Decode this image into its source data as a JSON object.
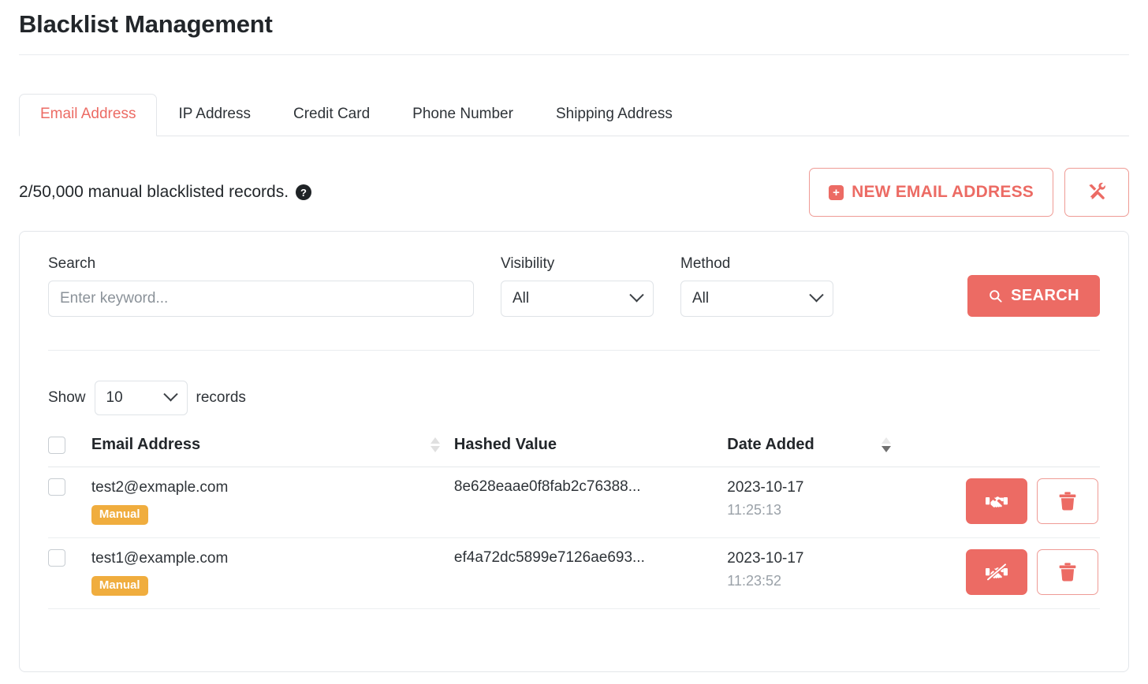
{
  "page": {
    "title": "Blacklist Management"
  },
  "tabs": [
    {
      "label": "Email Address",
      "active": true
    },
    {
      "label": "IP Address",
      "active": false
    },
    {
      "label": "Credit Card",
      "active": false
    },
    {
      "label": "Phone Number",
      "active": false
    },
    {
      "label": "Shipping Address",
      "active": false
    }
  ],
  "counter": {
    "text": "2/50,000 manual blacklisted records.",
    "help_icon": "question-circle-icon",
    "used": 2,
    "limit": "50,000"
  },
  "actions": {
    "new_record_label": "NEW EMAIL ADDRESS",
    "new_record_icon": "plus-square-icon",
    "plus_glyph": "+",
    "tools_icon": "tools-icon"
  },
  "filters": {
    "search": {
      "label": "Search",
      "placeholder": "Enter keyword...",
      "value": ""
    },
    "visibility": {
      "label": "Visibility",
      "value": "All",
      "options": [
        "All"
      ],
      "icon": "chevron-down-icon"
    },
    "method": {
      "label": "Method",
      "value": "All",
      "options": [
        "All"
      ],
      "icon": "chevron-down-icon"
    },
    "search_button": {
      "label": "SEARCH",
      "icon": "search-icon"
    }
  },
  "pagination": {
    "show_label": "Show",
    "page_size": "10",
    "page_size_options": [
      "10"
    ],
    "records_label": "records",
    "icon": "chevron-down-icon"
  },
  "table": {
    "columns": [
      {
        "key": "select",
        "label": "",
        "sortable": false
      },
      {
        "key": "email",
        "label": "Email Address",
        "sortable": true,
        "sort": "none"
      },
      {
        "key": "hash",
        "label": "Hashed Value",
        "sortable": false
      },
      {
        "key": "date",
        "label": "Date Added",
        "sortable": true,
        "sort": "desc"
      },
      {
        "key": "actions",
        "label": "",
        "sortable": false
      }
    ],
    "rows": [
      {
        "email": "test2@exmaple.com",
        "badge": "Manual",
        "hash": "8e628eaae0f8fab2c76388...",
        "date": "2023-10-17",
        "time": "11:25:13",
        "primary_action_icon": "handshake-icon",
        "delete_action_icon": "trash-icon"
      },
      {
        "email": "test1@example.com",
        "badge": "Manual",
        "hash": "ef4a72dc5899e7126ae693...",
        "date": "2023-10-17",
        "time": "11:23:52",
        "primary_action_icon": "handshake-slash-icon",
        "delete_action_icon": "trash-icon"
      }
    ]
  },
  "colors": {
    "accent": "#ec6b64",
    "accent_border": "#ef9b95",
    "badge_manual": "#f0ad3e",
    "text": "#2e3338",
    "muted": "#9aa1a8",
    "border": "#e3e6ea"
  }
}
